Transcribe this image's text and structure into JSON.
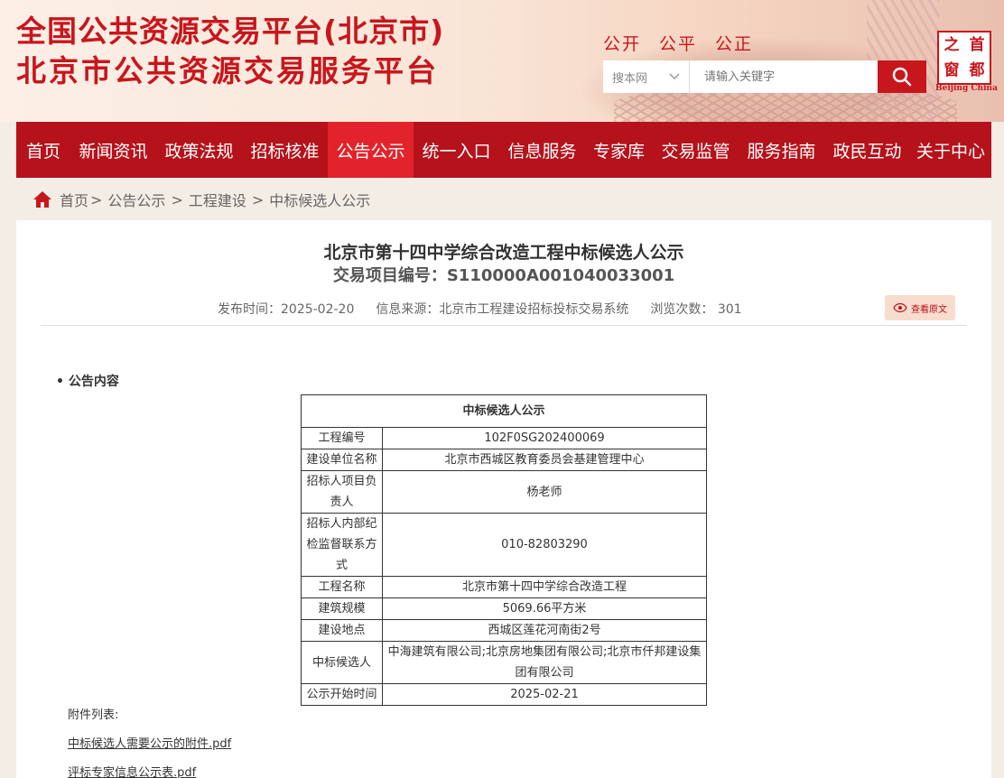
{
  "header": {
    "title_line1": "全国公共资源交易平台(北京市)",
    "title_line2": "北京市公共资源交易服务平台",
    "slogans": [
      "公开",
      "公平",
      "公正"
    ],
    "search": {
      "scope": "搜本网",
      "placeholder": "请输入关键字"
    },
    "logo": {
      "chars": [
        "之",
        "首",
        "窗",
        "都"
      ],
      "english": "Beijing China"
    }
  },
  "nav": {
    "items": [
      {
        "label": "首页"
      },
      {
        "label": "新闻资讯"
      },
      {
        "label": "政策法规"
      },
      {
        "label": "招标核准"
      },
      {
        "label": "公告公示"
      },
      {
        "label": "统一入口"
      },
      {
        "label": "信息服务"
      },
      {
        "label": "专家库"
      },
      {
        "label": "交易监管"
      },
      {
        "label": "服务指南"
      },
      {
        "label": "政民互动"
      },
      {
        "label": "关于中心"
      }
    ]
  },
  "breadcrumb": {
    "home": "首页",
    "items": [
      "公告公示",
      "工程建设",
      "中标候选人公示"
    ],
    "sep": ">"
  },
  "article": {
    "title": "北京市第十四中学综合改造工程中标候选人公示",
    "project_no": "交易项目编号：S110000A001040033001",
    "publish_time": "发布时间：2025-02-20",
    "source": "信息来源：北京市工程建设招标投标交易系统",
    "views": "浏览次数：  301",
    "view_original": "查看原文",
    "section_label": "• 公告内容"
  },
  "table": {
    "header": "中标候选人公示",
    "rows": [
      {
        "key": "工程编号",
        "value": "102F0SG202400069"
      },
      {
        "key": "建设单位名称",
        "value": "北京市西城区教育委员会基建管理中心"
      },
      {
        "key": "招标人项目负责人",
        "value": "杨老师"
      },
      {
        "key": "招标人内部纪检监督联系方式",
        "value": "010-82803290"
      },
      {
        "key": "工程名称",
        "value": "北京市第十四中学综合改造工程"
      },
      {
        "key": "建筑规模",
        "value": "5069.66平方米"
      },
      {
        "key": "建设地点",
        "value": "西城区莲花河南街2号"
      },
      {
        "key": "中标候选人",
        "value": "中海建筑有限公司;北京房地集团有限公司;北京市仟邦建设集团有限公司"
      },
      {
        "key": "公示开始时间",
        "value": "2025-02-21"
      }
    ]
  },
  "attachments": {
    "label": "附件列表:",
    "files": [
      "中标候选人需要公示的附件.pdf",
      "评标专家信息公示表.pdf"
    ]
  },
  "colors": {
    "brand_red": "#c8161d",
    "nav_bg": "#b5121b",
    "nav_active": "#e2232b"
  }
}
